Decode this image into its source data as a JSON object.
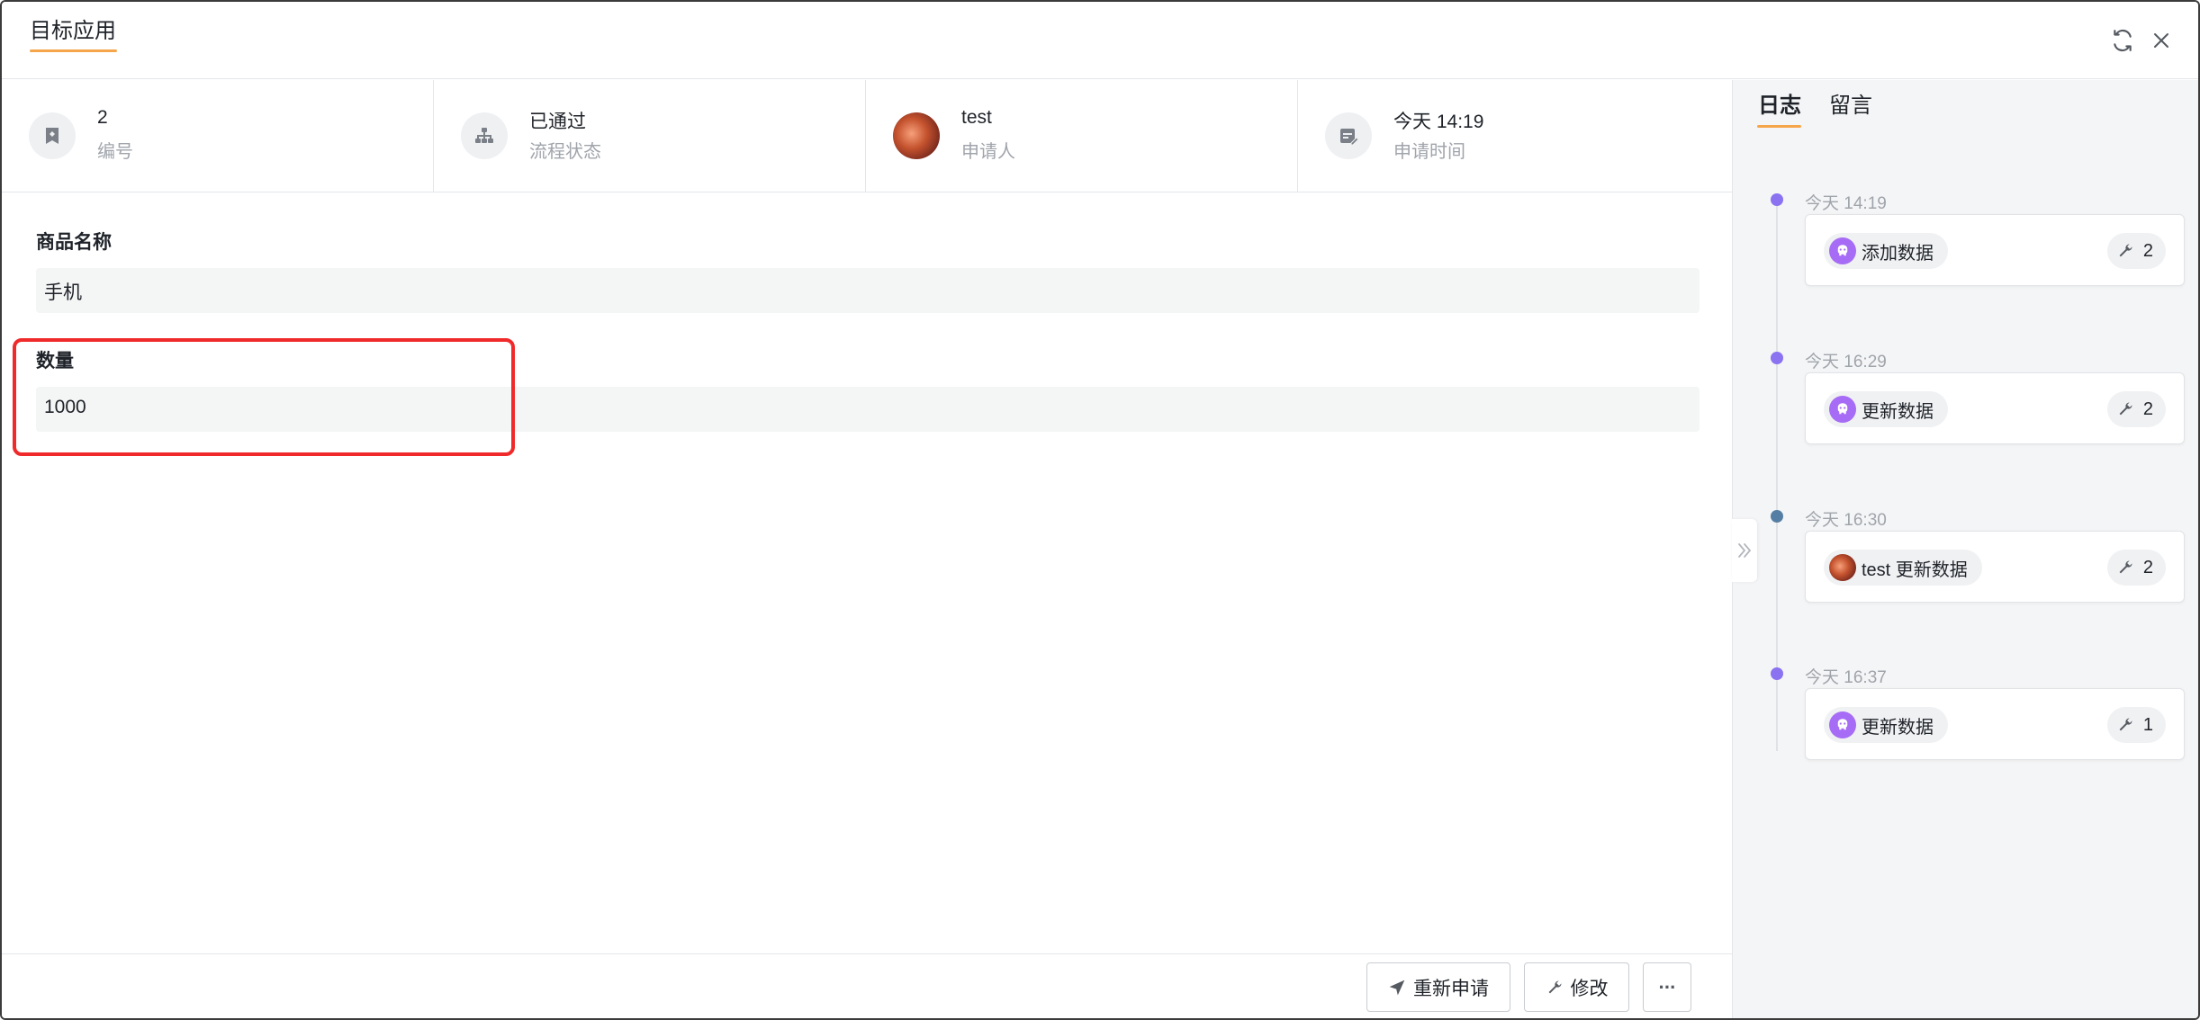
{
  "header": {
    "title": "目标应用"
  },
  "stats": [
    {
      "value": "2",
      "label": "编号",
      "icon": "bookmark-icon"
    },
    {
      "value": "已通过",
      "label": "流程状态",
      "icon": "org-chart-icon"
    },
    {
      "value": "test",
      "label": "申请人",
      "icon": "avatar"
    },
    {
      "value": "今天 14:19",
      "label": "申请时间",
      "icon": "calendar-edit-icon"
    }
  ],
  "fields": [
    {
      "label": "商品名称",
      "value": "手机"
    },
    {
      "label": "数量",
      "value": "1000"
    }
  ],
  "footer": {
    "reapply_label": "重新申请",
    "edit_label": "修改",
    "more_label": "···"
  },
  "side": {
    "tabs": [
      "日志",
      "留言"
    ],
    "active_tab": "日志",
    "log": [
      {
        "time": "今天 14:19",
        "actor_type": "bot",
        "action": "添加数据",
        "count": "2"
      },
      {
        "time": "今天 16:29",
        "actor_type": "bot",
        "action": "更新数据",
        "count": "2"
      },
      {
        "time": "今天 16:30",
        "actor_type": "user",
        "action": "test 更新数据",
        "count": "2"
      },
      {
        "time": "今天 16:37",
        "actor_type": "bot",
        "action": "更新数据",
        "count": "1"
      }
    ]
  },
  "colors": {
    "accent": "#f5a54a",
    "highlight": "#f02a2a",
    "timeline_dot": "#8a72f0",
    "bot_avatar": "#a66cf5"
  }
}
